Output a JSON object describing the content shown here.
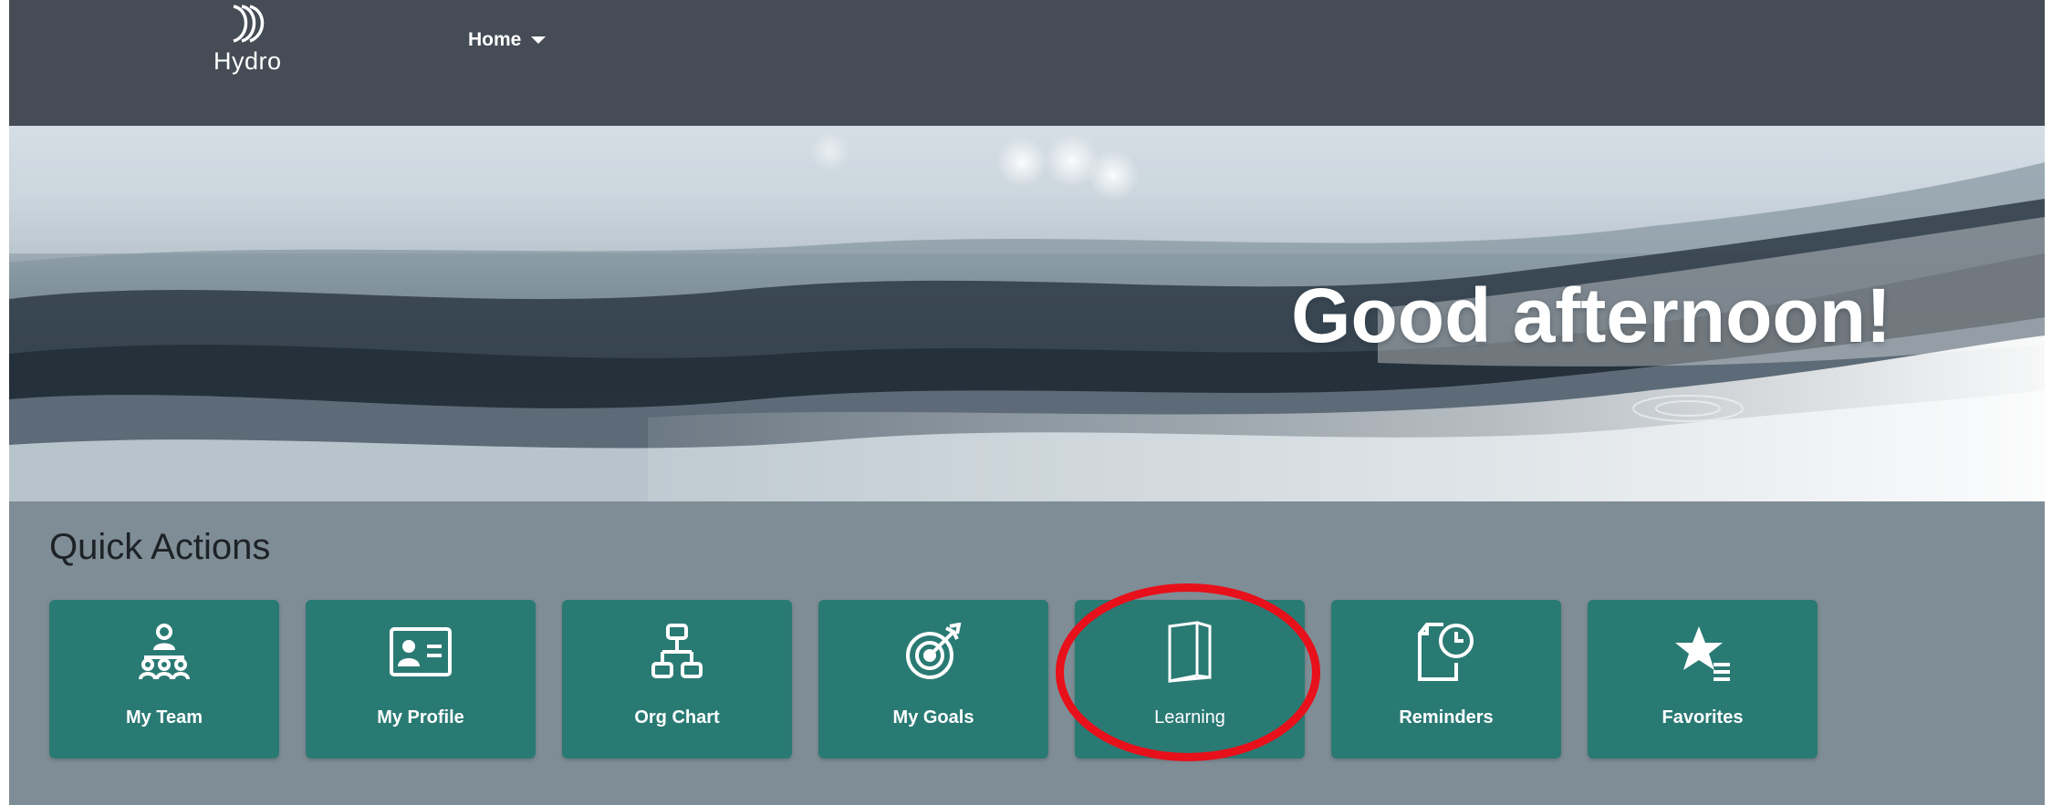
{
  "header": {
    "logo_text": "Hydro",
    "nav_label": "Home"
  },
  "banner": {
    "greeting": "Good afternoon!"
  },
  "quick_actions": {
    "title": "Quick Actions",
    "tiles": [
      {
        "label": "My Team",
        "icon": "team-icon"
      },
      {
        "label": "My Profile",
        "icon": "profile-card-icon"
      },
      {
        "label": "Org Chart",
        "icon": "org-chart-icon"
      },
      {
        "label": "My Goals",
        "icon": "target-icon"
      },
      {
        "label": "Learning",
        "icon": "book-icon"
      },
      {
        "label": "Reminders",
        "icon": "reminder-icon"
      },
      {
        "label": "Favorites",
        "icon": "star-list-icon"
      }
    ]
  },
  "annotation": {
    "color": "#e8101a",
    "target": "Learning"
  },
  "colors": {
    "header": "#454c56",
    "tile": "#2a7a74",
    "background": "#7f8d96"
  }
}
